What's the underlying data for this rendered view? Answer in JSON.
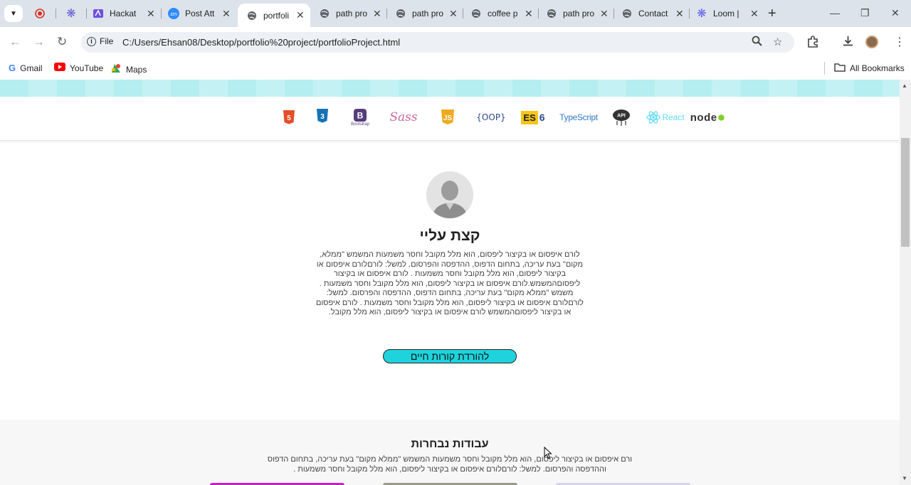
{
  "browser": {
    "tabs": [
      {
        "title": "",
        "icon": "record-icon",
        "color": "#d93025"
      },
      {
        "title": "",
        "icon": "snowflake-icon",
        "color": "#6b5bd6"
      },
      {
        "title": "Hackat",
        "icon": "hackathon-icon",
        "color": "#6f4fe0"
      },
      {
        "title": "Post Att",
        "icon": "zoom-icon",
        "color": "#2d8cff"
      },
      {
        "title": "portfoli",
        "icon": "globe-icon",
        "active": true
      },
      {
        "title": "path pro",
        "icon": "globe-icon"
      },
      {
        "title": "path pro",
        "icon": "globe-icon"
      },
      {
        "title": "coffee p",
        "icon": "globe-icon"
      },
      {
        "title": "path pro",
        "icon": "globe-icon"
      },
      {
        "title": "Contact",
        "icon": "globe-icon"
      },
      {
        "title": "Loom |",
        "icon": "loom-icon",
        "color": "#625df5"
      }
    ],
    "omnibox": {
      "scheme_label": "File",
      "url": "C:/Users/Ehsan08/Desktop/portfolio%20project/portfolioProject.html"
    },
    "bookmarks": [
      {
        "label": "Gmail",
        "icon": "google-icon"
      },
      {
        "label": "YouTube",
        "icon": "youtube-icon"
      },
      {
        "label": "Maps",
        "icon": "maps-icon"
      }
    ],
    "all_bookmarks": "All Bookmarks"
  },
  "page": {
    "skills": [
      {
        "name": "html5-icon",
        "label": "5"
      },
      {
        "name": "css3-icon",
        "label": "3"
      },
      {
        "name": "bootstrap-icon",
        "label": "B",
        "sub": "Bootstrap"
      },
      {
        "name": "sass-icon",
        "label": "Sass"
      },
      {
        "name": "javascript-icon",
        "label": "JS"
      },
      {
        "name": "oop-icon",
        "label": "{OOP}"
      },
      {
        "name": "es6-icon",
        "label": "ES",
        "num": "6"
      },
      {
        "name": "typescript-icon",
        "label": "TypeScript"
      },
      {
        "name": "api-icon",
        "label": "API"
      },
      {
        "name": "react-icon",
        "label": "React"
      },
      {
        "name": "node-icon",
        "label": "node"
      }
    ],
    "about": {
      "title": "קצת עליי",
      "text": "לורם איפסום או בקיצור ליפסום, הוא מלל מקובל וחסר משמעות המשמש \"ממלא, מקום\" בעת עריכה, בתחום הדפוס, ההדפסה והפרסום. למשל: לורםלורם איפסום או בקיצור ליפסום, הוא מלל מקובל וחסר משמעות . לורם איפסום או בקיצור ליפסוםהמשמש.לורם איפסום או בקיצור ליפסום, הוא מלל מקובל וחסר משמעות . משמש \"ממלא מקום\" בעת עריכה, בתחום הדפוס, ההדפסה והפרסום. למשל: לורםלורם איפסום או בקיצור ליפסום, הוא מלל מקובל וחסר משמעות . לורם איפסום או בקיצור ליפסוםהמשמש לורם איפסום או בקיצור ליפסום, הוא מלל מקובל.",
      "cv_button": "להורדת קורות חיים"
    },
    "works": {
      "title": "עבודות נבחרות",
      "text": "ורם איפסום או בקיצור ליפסום, הוא מלל מקובל וחסר משמעות המשמש \"ממלא מקום\" בעת עריכה, בתחום הדפוס וההדפסה והפרסום. למשל: לורםלורם איפסום או בקיצור ליפסום, הוא מלל מקובל וחסר משמעות ."
    }
  }
}
